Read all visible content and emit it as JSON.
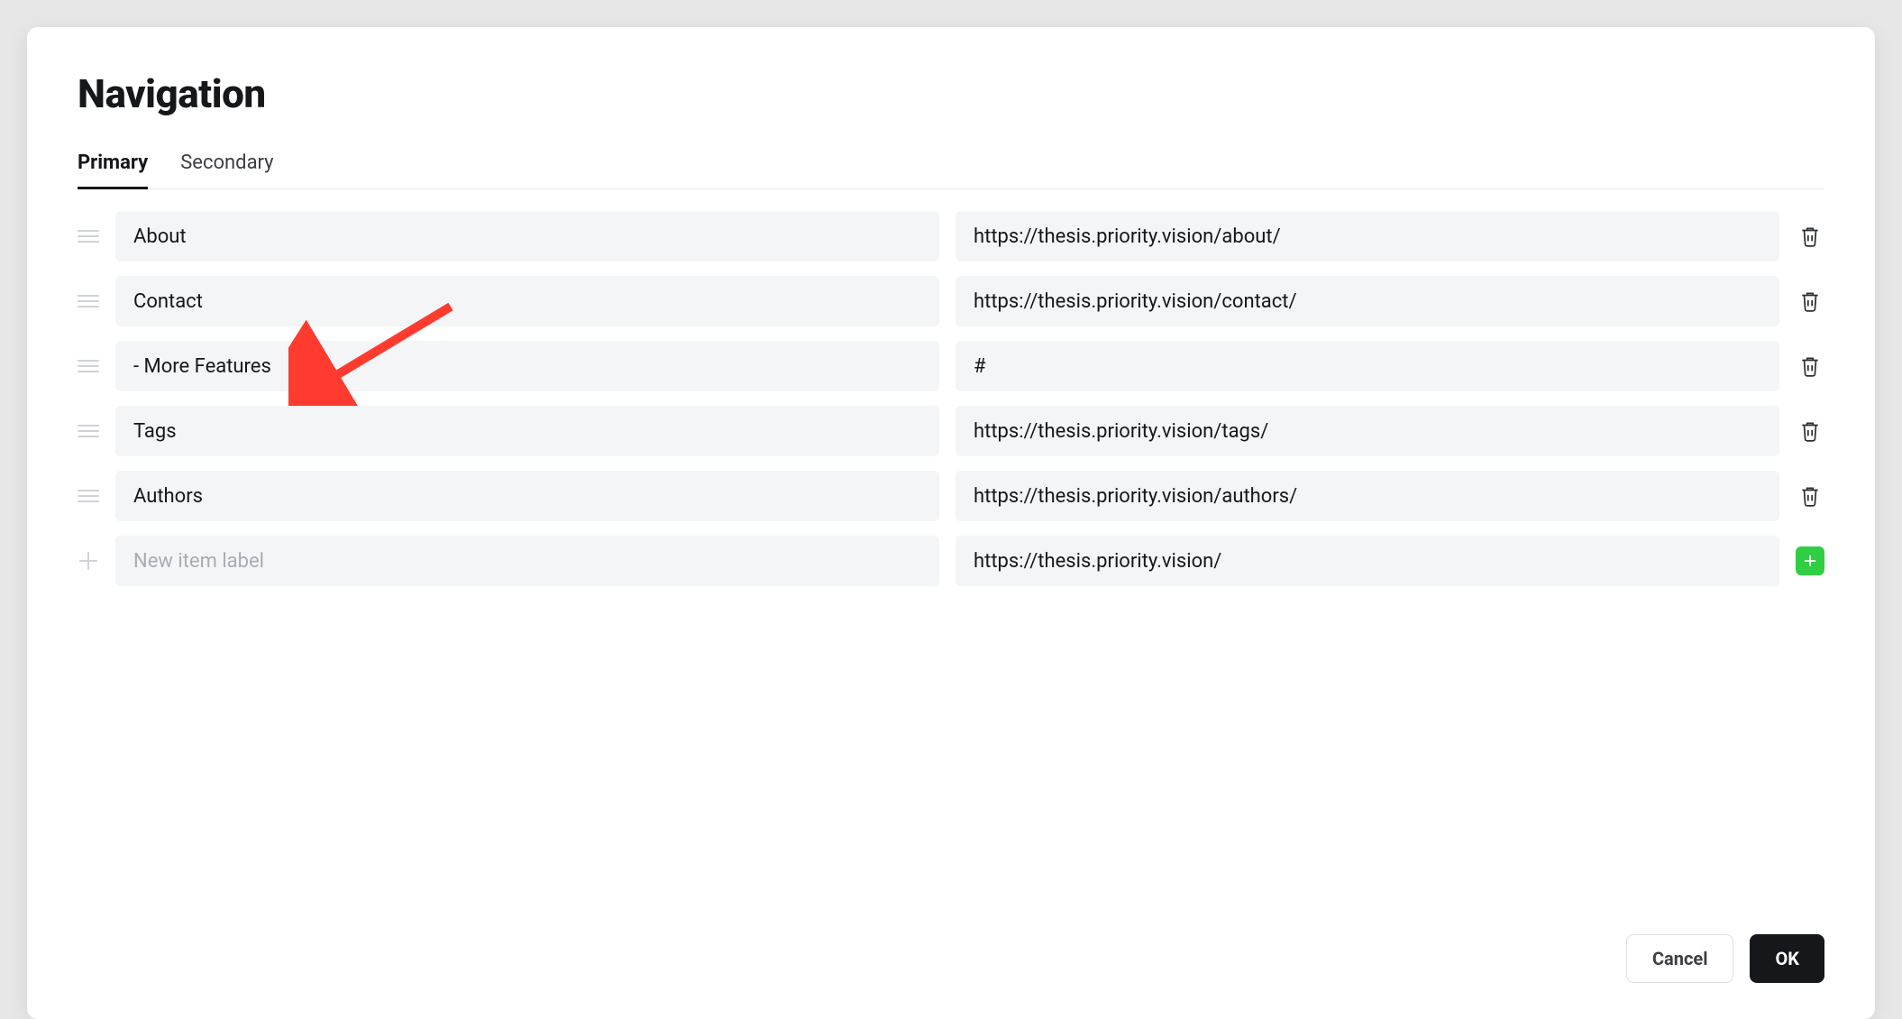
{
  "title": "Navigation",
  "tabs": {
    "primary": "Primary",
    "secondary": "Secondary"
  },
  "rows": [
    {
      "label": "About",
      "url": "https://thesis.priority.vision/about/"
    },
    {
      "label": "Contact",
      "url": "https://thesis.priority.vision/contact/"
    },
    {
      "label": "- More Features",
      "url": "#"
    },
    {
      "label": "Tags",
      "url": "https://thesis.priority.vision/tags/"
    },
    {
      "label": "Authors",
      "url": "https://thesis.priority.vision/authors/"
    }
  ],
  "new_row": {
    "label_placeholder": "New item label",
    "url_value": "https://thesis.priority.vision/"
  },
  "buttons": {
    "cancel": "Cancel",
    "ok": "OK"
  }
}
